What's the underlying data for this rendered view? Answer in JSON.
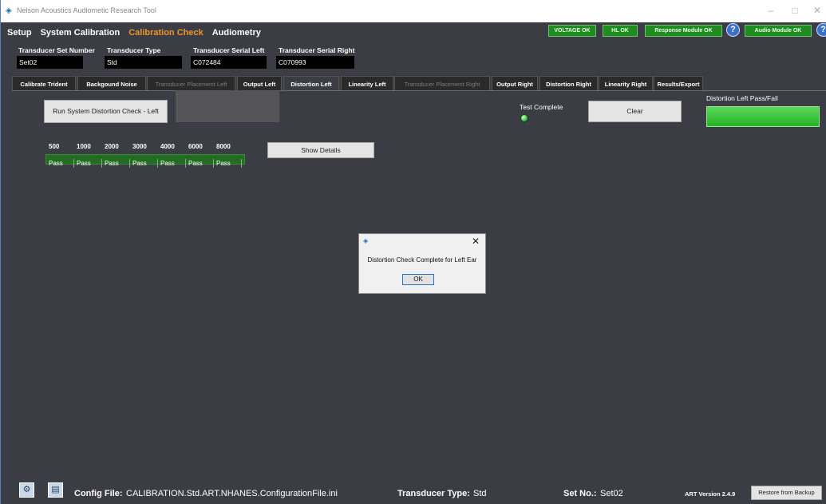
{
  "window": {
    "title": "Nelson Acoustics Audiometic Research Tool",
    "minimize": "–",
    "maximize": "□",
    "close": "✕"
  },
  "menu": [
    "Setup",
    "System Calibration",
    "Calibration Check",
    "Audiometry"
  ],
  "menu_active": "Calibration Check",
  "status": {
    "voltage": "VOLTAGE OK",
    "hl": "HL OK",
    "response_module": "Response Module OK",
    "audio_module": "Audio Module OK",
    "help_glyph": "?"
  },
  "transducer": {
    "set_number_label": "Transducer Set Number",
    "set_number": "Set02",
    "type_label": "Transducer Type",
    "type": "Std",
    "serial_left_label": "Transducer Serial Left",
    "serial_left": "C072484",
    "serial_right_label": "Transducer Serial Right",
    "serial_right": "C070993"
  },
  "tabs": [
    {
      "label": "Calibrate Trident",
      "state": "enabled"
    },
    {
      "label": "Backgound Noise",
      "state": "enabled"
    },
    {
      "label": "Transducer Placement Left",
      "state": "disabled"
    },
    {
      "label": "Output Left",
      "state": "enabled"
    },
    {
      "label": "Distortion Left",
      "state": "active"
    },
    {
      "label": "Linearity Left",
      "state": "enabled"
    },
    {
      "label": "Transducer Placement Right",
      "state": "disabled"
    },
    {
      "label": "Output Right",
      "state": "enabled"
    },
    {
      "label": "Distortion Right",
      "state": "enabled"
    },
    {
      "label": "Linearity Right",
      "state": "enabled"
    },
    {
      "label": "Results/Export",
      "state": "enabled"
    }
  ],
  "content": {
    "run_button": "Run System Distortion Check - Left",
    "test_complete_label": "Test Complete",
    "clear_button": "Clear",
    "passfail_label": "Distortion Left Pass/Fail",
    "show_details_button": "Show Details",
    "frequencies": [
      "500",
      "1000",
      "2000",
      "3000",
      "4000",
      "6000",
      "8000"
    ],
    "results": [
      "Pass",
      "Pass",
      "Pass",
      "Pass",
      "Pass",
      "Pass",
      "Pass"
    ]
  },
  "dialog": {
    "message": "Distortion Check Complete for Left Ear",
    "ok": "OK",
    "close": "✕"
  },
  "footer": {
    "config_label": "Config File:",
    "config_value": "CALIBRATION.Std.ART.NHANES.ConfigurationFile.ini",
    "type_label": "Transducer Type:",
    "type_value": "Std",
    "set_label": "Set No.:",
    "set_value": "Set02",
    "version": "ART Version 2.4.9",
    "restore_button": "Restore from Backup"
  },
  "colors": {
    "background": "#3c3c44",
    "accent_active_menu": "#e8962a",
    "status_ok": "#1e8c1e",
    "pass_green": "#2fbf2f"
  }
}
